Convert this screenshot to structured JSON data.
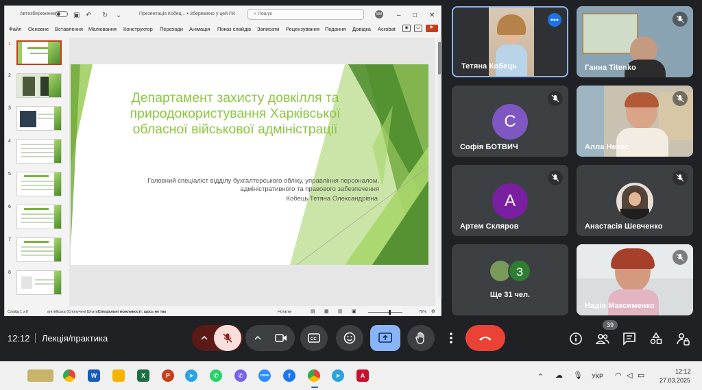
{
  "ppt": {
    "autosave_label": "Автозбереження",
    "doc_title": "Презентація Кобец... • Збережено у цей ПК",
    "search_placeholder": "Пошук",
    "user_initials": "ММ",
    "menu": [
      "Файл",
      "Основне",
      "Вставлення",
      "Малювання",
      "Конструктор",
      "Переходи",
      "Анімація",
      "Показ слайдів",
      "Записати",
      "Рецензування",
      "Подання",
      "Довідка",
      "Acrobat"
    ],
    "slide_numbers": [
      "1",
      "2",
      "3",
      "4",
      "5",
      "6",
      "7",
      "8"
    ],
    "slide": {
      "title": "Департамент захисту довкілля та природокористування Харківської обласної військової адміністрації",
      "subtitle": "Головний спеціаліст відділу бухгалтерського обліку, управління персоналом, адміністративного та правового забезпечення",
      "author": "Кобець Тетяна Олександрівна"
    },
    "status": {
      "slide_counter": "Слайд 1 з 8",
      "language": "англійська (Сполучені Штати)",
      "accessibility": "Спеціальні можливості: щось не так",
      "notes": "Нотатки",
      "zoom": "75%"
    }
  },
  "participants": [
    {
      "name": "Тетяна Кобець",
      "speaking": true
    },
    {
      "name": "Ганна Titenko",
      "muted": true
    },
    {
      "name": "Софія БОТВИЧ",
      "muted": true,
      "initial": "С",
      "color": "#7e57c2"
    },
    {
      "name": "Алла Некос",
      "muted": true
    },
    {
      "name": "Артем Скляров",
      "muted": true,
      "initial": "А",
      "color": "#7b1fa2"
    },
    {
      "name": "Анастасія Шевченко",
      "muted": true
    },
    {
      "name": "Ще 31 чел.",
      "initial": "З",
      "color": "#2e7d32"
    },
    {
      "name": "Надія Максименко",
      "muted": true
    }
  ],
  "meet": {
    "time": "12:12",
    "meeting_name": "Лекція/практика",
    "participants_count": "39"
  },
  "taskbar": {
    "lang": "УКР",
    "time": "12:12",
    "date": "27.03.2025"
  },
  "colors": {
    "accent_green": "#8cc63f",
    "end_call": "#ea4335",
    "present_active": "#8ab4f8",
    "mic_off_bg": "#f9dedc"
  }
}
